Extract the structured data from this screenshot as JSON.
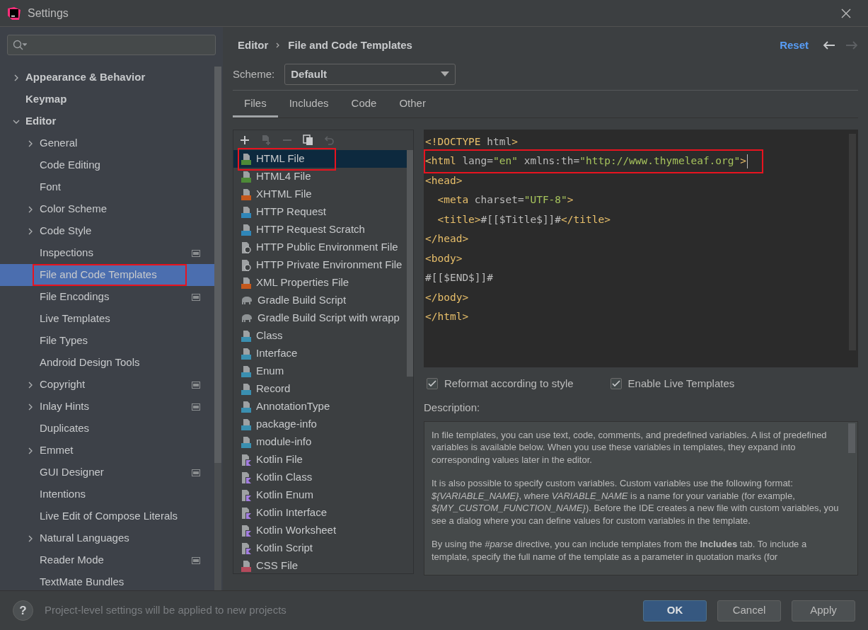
{
  "window": {
    "title": "Settings"
  },
  "sidebar": {
    "items": [
      {
        "label": "Appearance & Behavior",
        "expanded": false,
        "selected": false,
        "highlighted": false,
        "project_level": false
      },
      {
        "label": "Keymap",
        "selected": false,
        "highlighted": false,
        "project_level": false
      },
      {
        "label": "Editor",
        "expanded": true,
        "selected": false,
        "highlighted": false,
        "project_level": false,
        "children": [
          {
            "label": "General",
            "expanded": false,
            "selected": false,
            "highlighted": false,
            "project_level": false
          },
          {
            "label": "Code Editing",
            "selected": false,
            "highlighted": false,
            "project_level": false
          },
          {
            "label": "Font",
            "selected": false,
            "highlighted": false,
            "project_level": false
          },
          {
            "label": "Color Scheme",
            "expanded": false,
            "selected": false,
            "highlighted": false,
            "project_level": false
          },
          {
            "label": "Code Style",
            "expanded": false,
            "selected": false,
            "highlighted": false,
            "project_level": false
          },
          {
            "label": "Inspections",
            "selected": false,
            "highlighted": false,
            "project_level": true
          },
          {
            "label": "File and Code Templates",
            "selected": true,
            "highlighted": true,
            "project_level": false
          },
          {
            "label": "File Encodings",
            "selected": false,
            "highlighted": false,
            "project_level": true
          },
          {
            "label": "Live Templates",
            "selected": false,
            "highlighted": false,
            "project_level": false
          },
          {
            "label": "File Types",
            "selected": false,
            "highlighted": false,
            "project_level": false
          },
          {
            "label": "Android Design Tools",
            "selected": false,
            "highlighted": false,
            "project_level": false
          },
          {
            "label": "Copyright",
            "expanded": false,
            "selected": false,
            "highlighted": false,
            "project_level": true
          },
          {
            "label": "Inlay Hints",
            "expanded": false,
            "selected": false,
            "highlighted": false,
            "project_level": true
          },
          {
            "label": "Duplicates",
            "selected": false,
            "highlighted": false,
            "project_level": false
          },
          {
            "label": "Emmet",
            "expanded": false,
            "selected": false,
            "highlighted": false,
            "project_level": false
          },
          {
            "label": "GUI Designer",
            "selected": false,
            "highlighted": false,
            "project_level": true
          },
          {
            "label": "Intentions",
            "selected": false,
            "highlighted": false,
            "project_level": false
          },
          {
            "label": "Live Edit of Compose Literals",
            "selected": false,
            "highlighted": false,
            "project_level": false
          },
          {
            "label": "Natural Languages",
            "expanded": false,
            "selected": false,
            "highlighted": false,
            "project_level": false
          },
          {
            "label": "Reader Mode",
            "selected": false,
            "highlighted": false,
            "project_level": true
          },
          {
            "label": "TextMate Bundles",
            "selected": false,
            "highlighted": false,
            "project_level": false
          }
        ]
      }
    ]
  },
  "breadcrumb": [
    "Editor",
    "File and Code Templates"
  ],
  "header_actions": {
    "reset": "Reset",
    "back_disabled": false,
    "forward_disabled": true
  },
  "scheme": {
    "label": "Scheme:",
    "value": "Default"
  },
  "tabs": [
    {
      "label": "Files",
      "selected": true
    },
    {
      "label": "Includes",
      "selected": false
    },
    {
      "label": "Code",
      "selected": false
    },
    {
      "label": "Other",
      "selected": false
    }
  ],
  "toolbar": [
    {
      "kind": "add",
      "disabled": false
    },
    {
      "kind": "add-child",
      "disabled": true
    },
    {
      "kind": "remove",
      "disabled": true
    },
    {
      "kind": "copy",
      "disabled": false
    },
    {
      "kind": "reset",
      "disabled": true
    }
  ],
  "templates": [
    {
      "label": "HTML File",
      "kind": "html",
      "selected": true,
      "highlighted": true
    },
    {
      "label": "HTML4 File",
      "kind": "html",
      "selected": false,
      "highlighted": false
    },
    {
      "label": "XHTML File",
      "kind": "xhtml",
      "selected": false,
      "highlighted": false
    },
    {
      "label": "HTTP Request",
      "kind": "api",
      "selected": false,
      "highlighted": false
    },
    {
      "label": "HTTP Request Scratch",
      "kind": "api",
      "selected": false,
      "highlighted": false
    },
    {
      "label": "HTTP Public Environment File",
      "kind": "env",
      "selected": false,
      "highlighted": false
    },
    {
      "label": "HTTP Private Environment File",
      "kind": "env",
      "selected": false,
      "highlighted": false
    },
    {
      "label": "XML Properties File",
      "kind": "xml",
      "selected": false,
      "highlighted": false
    },
    {
      "label": "Gradle Build Script",
      "kind": "gradle",
      "selected": false,
      "highlighted": false
    },
    {
      "label": "Gradle Build Script with wrapp",
      "kind": "gradle",
      "selected": false,
      "highlighted": false
    },
    {
      "label": "Class",
      "kind": "java",
      "selected": false,
      "highlighted": false
    },
    {
      "label": "Interface",
      "kind": "java",
      "selected": false,
      "highlighted": false
    },
    {
      "label": "Enum",
      "kind": "java",
      "selected": false,
      "highlighted": false
    },
    {
      "label": "Record",
      "kind": "java",
      "selected": false,
      "highlighted": false
    },
    {
      "label": "AnnotationType",
      "kind": "java",
      "selected": false,
      "highlighted": false
    },
    {
      "label": "package-info",
      "kind": "java",
      "selected": false,
      "highlighted": false
    },
    {
      "label": "module-info",
      "kind": "java",
      "selected": false,
      "highlighted": false
    },
    {
      "label": "Kotlin File",
      "kind": "kotlin",
      "selected": false,
      "highlighted": false
    },
    {
      "label": "Kotlin Class",
      "kind": "kotlin",
      "selected": false,
      "highlighted": false
    },
    {
      "label": "Kotlin Enum",
      "kind": "kotlin",
      "selected": false,
      "highlighted": false
    },
    {
      "label": "Kotlin Interface",
      "kind": "kotlin",
      "selected": false,
      "highlighted": false
    },
    {
      "label": "Kotlin Worksheet",
      "kind": "kotlin",
      "selected": false,
      "highlighted": false
    },
    {
      "label": "Kotlin Script",
      "kind": "kotlin",
      "selected": false,
      "highlighted": false
    },
    {
      "label": "CSS File",
      "kind": "css",
      "selected": false,
      "highlighted": false
    }
  ],
  "code_lines": [
    {
      "highlighted": false,
      "tokens": [
        {
          "kind": "tag",
          "text": "<!DOCTYPE "
        },
        {
          "kind": "plain",
          "text": "html"
        },
        {
          "kind": "tag",
          "text": ">"
        }
      ]
    },
    {
      "highlighted": true,
      "tokens": [
        {
          "kind": "tag",
          "text": "<html "
        },
        {
          "kind": "plain",
          "text": "lang="
        },
        {
          "kind": "string",
          "text": "\"en\""
        },
        {
          "kind": "plain",
          "text": " xmlns:th="
        },
        {
          "kind": "string",
          "text": "\"http://www.thymeleaf.org\""
        },
        {
          "kind": "tag",
          "text": ">"
        }
      ]
    },
    {
      "highlighted": false,
      "tokens": [
        {
          "kind": "tag",
          "text": "<head>"
        }
      ]
    },
    {
      "highlighted": false,
      "tokens": [
        {
          "kind": "tag",
          "text": "  <meta "
        },
        {
          "kind": "plain",
          "text": "charset="
        },
        {
          "kind": "string",
          "text": "\"UTF-8\""
        },
        {
          "kind": "tag",
          "text": ">"
        }
      ]
    },
    {
      "highlighted": false,
      "tokens": [
        {
          "kind": "tag",
          "text": "  <title>"
        },
        {
          "kind": "plain",
          "text": "#[[$Title$]]#"
        },
        {
          "kind": "tag",
          "text": "</title>"
        }
      ]
    },
    {
      "highlighted": false,
      "tokens": [
        {
          "kind": "tag",
          "text": "</head>"
        }
      ]
    },
    {
      "highlighted": false,
      "tokens": [
        {
          "kind": "tag",
          "text": "<body>"
        }
      ]
    },
    {
      "highlighted": false,
      "tokens": [
        {
          "kind": "plain",
          "text": "#[[$END$]]#"
        }
      ]
    },
    {
      "highlighted": false,
      "tokens": [
        {
          "kind": "tag",
          "text": "</body>"
        }
      ]
    },
    {
      "highlighted": false,
      "tokens": [
        {
          "kind": "tag",
          "text": "</html>"
        }
      ]
    }
  ],
  "options": [
    {
      "label": "Reformat according to style",
      "checked": true
    },
    {
      "label": "Enable Live Templates",
      "checked": true
    }
  ],
  "description": {
    "label": "Description:",
    "paragraphs": [
      "In file templates, you can use text, code, comments, and predefined variables. A list of predefined variables is available below. When you use these variables in templates, they expand into corresponding values later in the editor.",
      "It is also possible to specify custom variables. Custom variables use the following format: *${VARIABLE_NAME}*, where *VARIABLE_NAME* is a name for your variable (for example, *${MY_CUSTOM_FUNCTION_NAME}*). Before the IDE creates a new file with custom variables, you see a dialog where you can define values for custom variables in the template.",
      "By using the *#parse* directive, you can include templates from the **Includes** tab. To include a template, specify the full name of the template as a parameter in quotation marks (for"
    ]
  },
  "footer": {
    "help": "?",
    "note": "Project-level settings will be applied to new projects",
    "buttons": [
      {
        "label": "OK",
        "kind": "primary"
      },
      {
        "label": "Cancel",
        "kind": "secondary"
      },
      {
        "label": "Apply",
        "kind": "secondary"
      }
    ]
  }
}
